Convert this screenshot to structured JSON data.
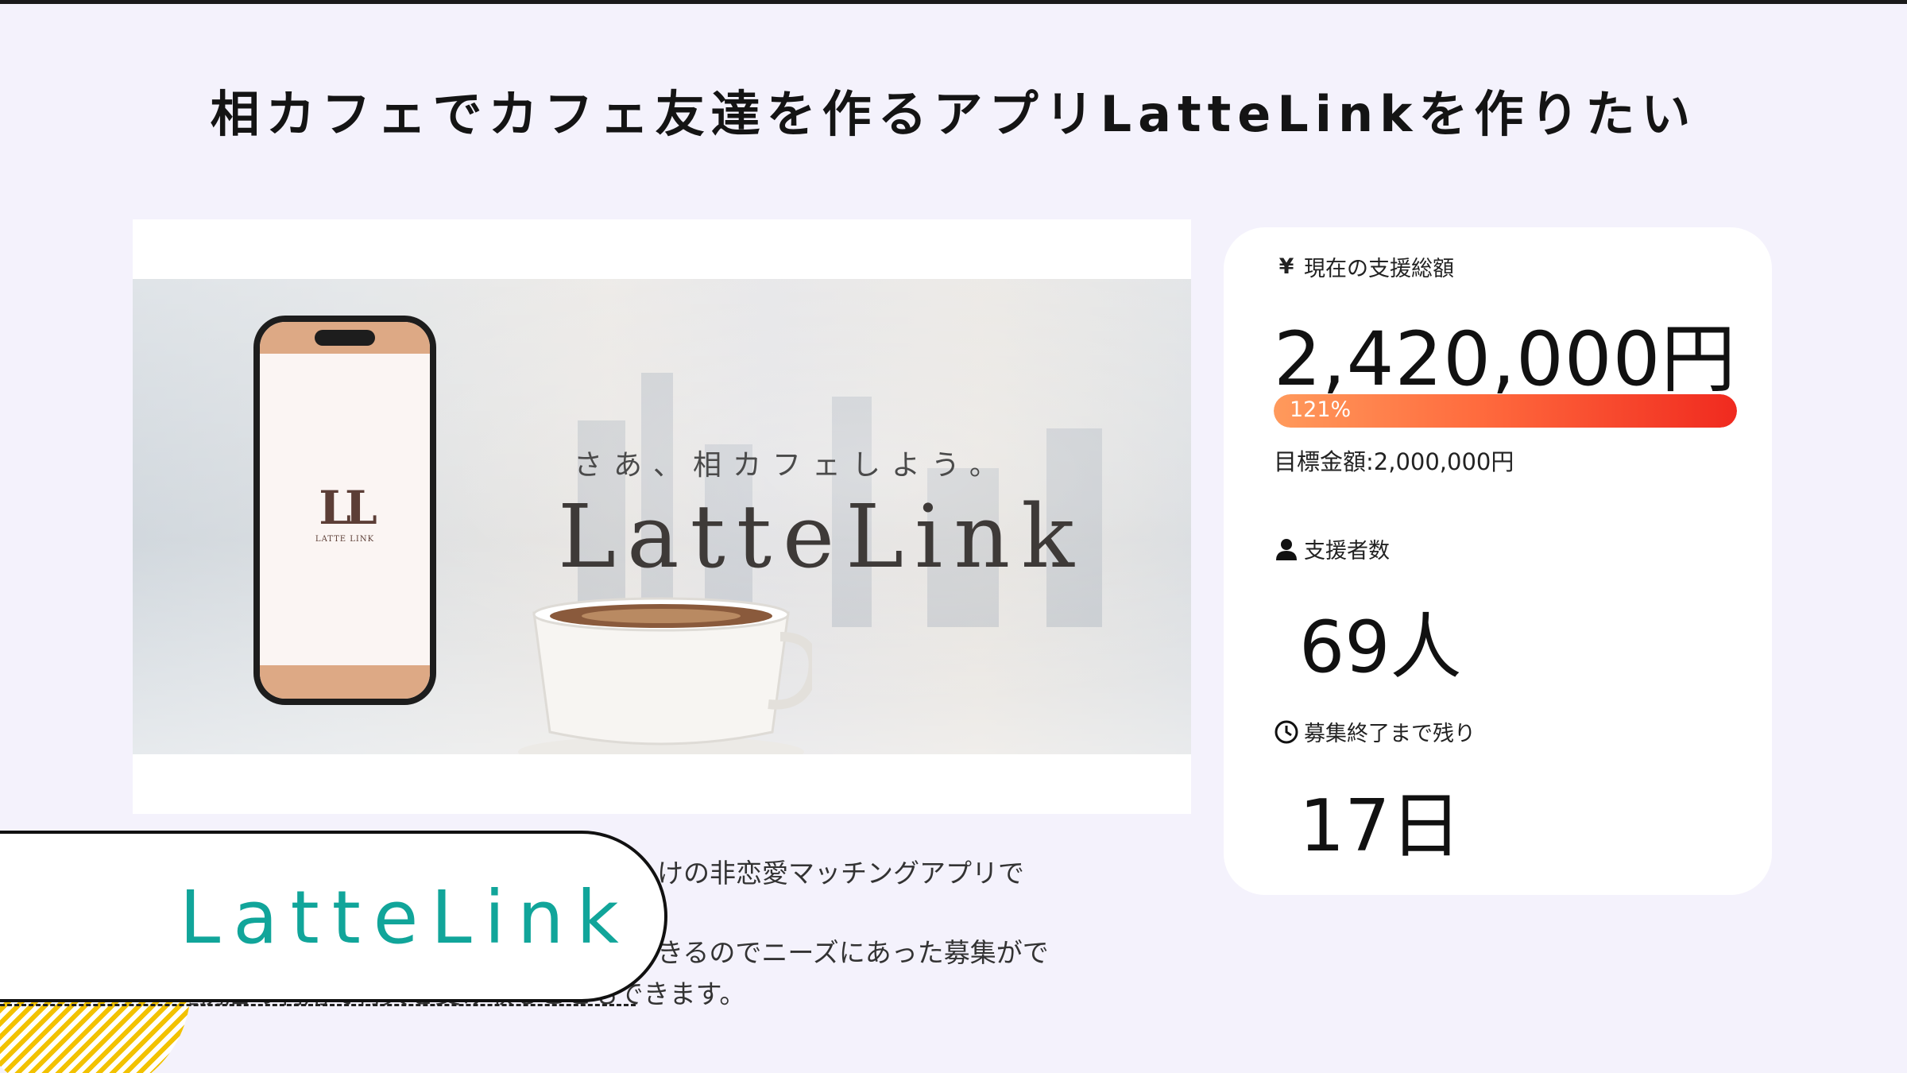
{
  "page": {
    "title": "相カフェでカフェ友達を作るアプリLatteLinkを作りたい"
  },
  "hero": {
    "tagline": "さあ、相カフェしよう。",
    "brand": "LatteLink",
    "phone_logo": "LL",
    "phone_logo_sub": "LATTE LINK"
  },
  "stats": {
    "amount_label": "現在の支援総額",
    "amount": "2,420,000円",
    "progress_label": "121%",
    "progress_fraction": 1.0,
    "goal": "目標金額:2,000,000円",
    "supporters_label": "支援者数",
    "supporters": "69人",
    "remaining_label": "募集終了まで残り",
    "remaining": "17日",
    "icons": {
      "amount": "yen-icon",
      "supporters": "person-icon",
      "remaining": "clock-icon"
    }
  },
  "description": {
    "line1": "けの非恋愛マッチングアプリで",
    "line2": "きるのでニーズにあった募集がで",
    "line3": "提携店の利用で特典を受け取ることもできます。"
  },
  "badge": {
    "text": "LatteLink"
  },
  "colors": {
    "background": "#f4f2fc",
    "accent_teal": "#11a59a",
    "progress_start": "#ff9a5c",
    "progress_end": "#f02a1f",
    "stripe_yellow": "#f2c200",
    "phone_band": "#dda985"
  }
}
